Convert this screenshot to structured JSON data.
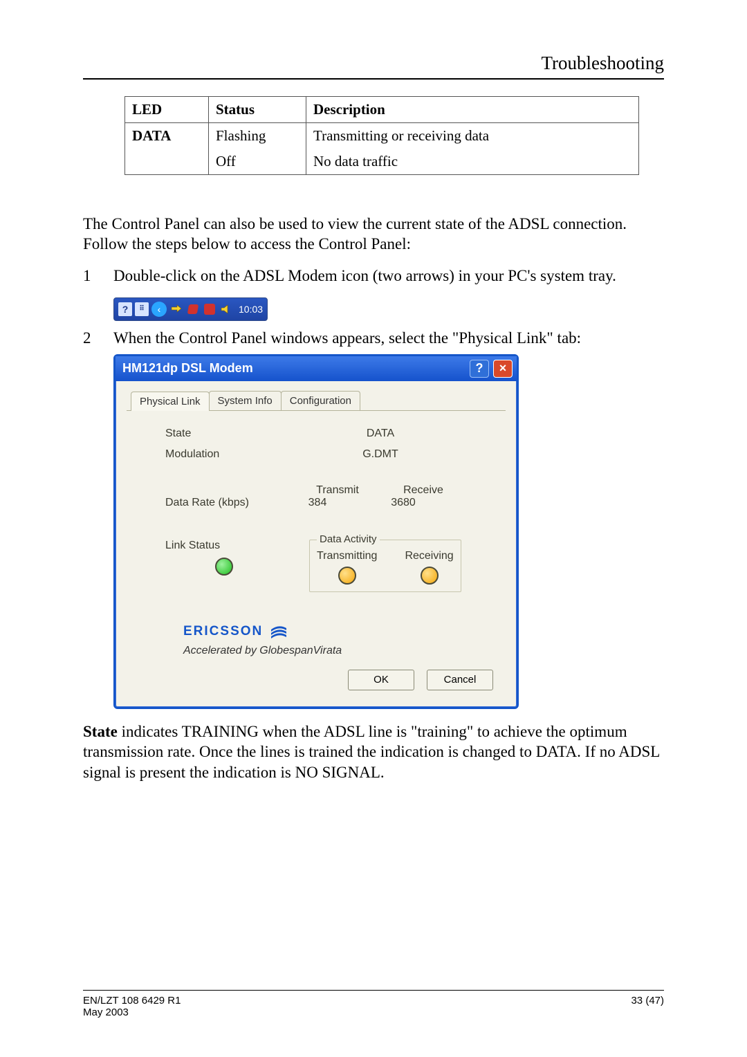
{
  "header": {
    "title": "Troubleshooting"
  },
  "led_table": {
    "headers": [
      "LED",
      "Status",
      "Description"
    ],
    "rows": [
      {
        "led": "DATA",
        "status": "Flashing",
        "description": "Transmitting or receiving data"
      },
      {
        "led": "",
        "status": "Off",
        "description": "No data traffic"
      }
    ]
  },
  "intro_paragraph": "The Control Panel can also be used to view the current state of the ADSL connection. Follow the steps below to access the Control Panel:",
  "steps": [
    "Double-click  on the ADSL Modem icon (two arrows) in your PC's  system tray.",
    "When the Control Panel windows appears, select the \"Physical Link\" tab:"
  ],
  "systray": {
    "time": "10:03",
    "help_glyph": "?",
    "chevron_glyph": "‹"
  },
  "dialog": {
    "title": "HM121dp DSL Modem",
    "help_glyph": "?",
    "close_glyph": "×",
    "tabs": [
      "Physical Link",
      "System Info",
      "Configuration"
    ],
    "active_tab": 0,
    "fields": {
      "state_label": "State",
      "state_value": "DATA",
      "modulation_label": "Modulation",
      "modulation_value": "G.DMT",
      "transmit_header": "Transmit",
      "receive_header": "Receive",
      "data_rate_label": "Data Rate (kbps)",
      "data_rate_tx": "384",
      "data_rate_rx": "3680",
      "link_status_label": "Link Status",
      "data_activity_label": "Data Activity",
      "transmitting_label": "Transmitting",
      "receiving_label": "Receiving"
    },
    "brand": "ERICSSON",
    "accelerated": "Accelerated by GlobespanVirata",
    "ok_label": "OK",
    "cancel_label": "Cancel"
  },
  "state_paragraph_plain": "State indicates TRAINING when the ADSL line is \"training\" to achieve the optimum transmission rate. Once the lines is trained the indication is changed to DATA. If no ADSL signal is present the indication is NO SIGNAL.",
  "state_paragraph": {
    "lead_bold": "State",
    "rest": " indicates TRAINING when the ADSL line is \"training\" to achieve the optimum transmission rate. Once the lines is trained the indication is changed to DATA. If no ADSL signal is present the indication is NO SIGNAL."
  },
  "footer": {
    "docnum": "EN/LZT 108 6429 R1",
    "page": "33 (47)",
    "date": "May 2003"
  }
}
